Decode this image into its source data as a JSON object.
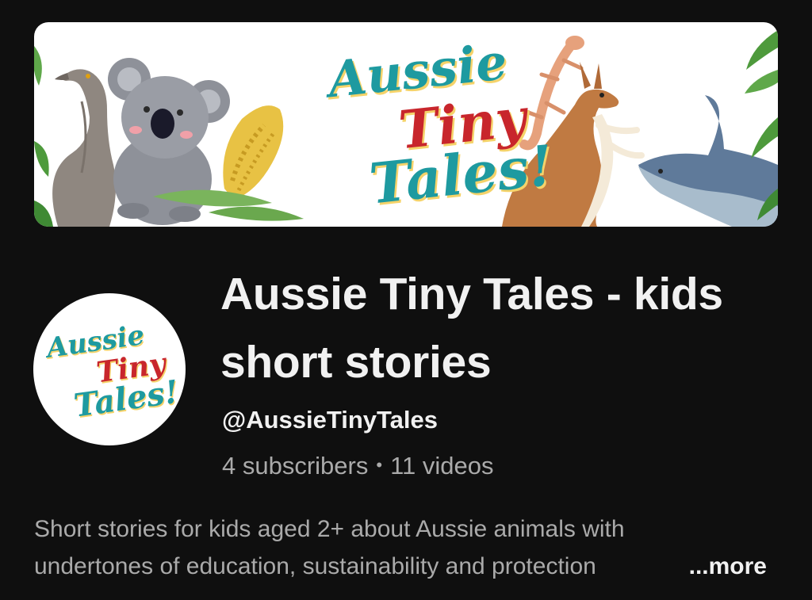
{
  "banner": {
    "wordmark": [
      "Aussie",
      "Tiny",
      "Tales!"
    ]
  },
  "avatar": {
    "wordmark": [
      "Aussie",
      "Tiny",
      "Tales!"
    ]
  },
  "channel": {
    "title": "Aussie Tiny Tales - kids short stories",
    "handle": "@AussieTinyTales",
    "subscribers": "4 subscribers",
    "separator": "•",
    "videos": "11 videos"
  },
  "description": {
    "line1": "Short stories for kids aged 2+ about Aussie animals with",
    "line2": "undertones of education, sustainability and protection",
    "more_label": "...more"
  },
  "colors": {
    "background": "#0f0f0f",
    "primary_text": "#f1f1f1",
    "secondary_text": "#aaaaaa",
    "brand_teal": "#1e9aa0",
    "brand_red": "#c8262c"
  },
  "icons": [
    "emu-illustration",
    "koala-illustration",
    "banksia-illustration",
    "gecko-illustration",
    "kangaroo-illustration",
    "stingray-illustration",
    "leaf-illustration"
  ]
}
